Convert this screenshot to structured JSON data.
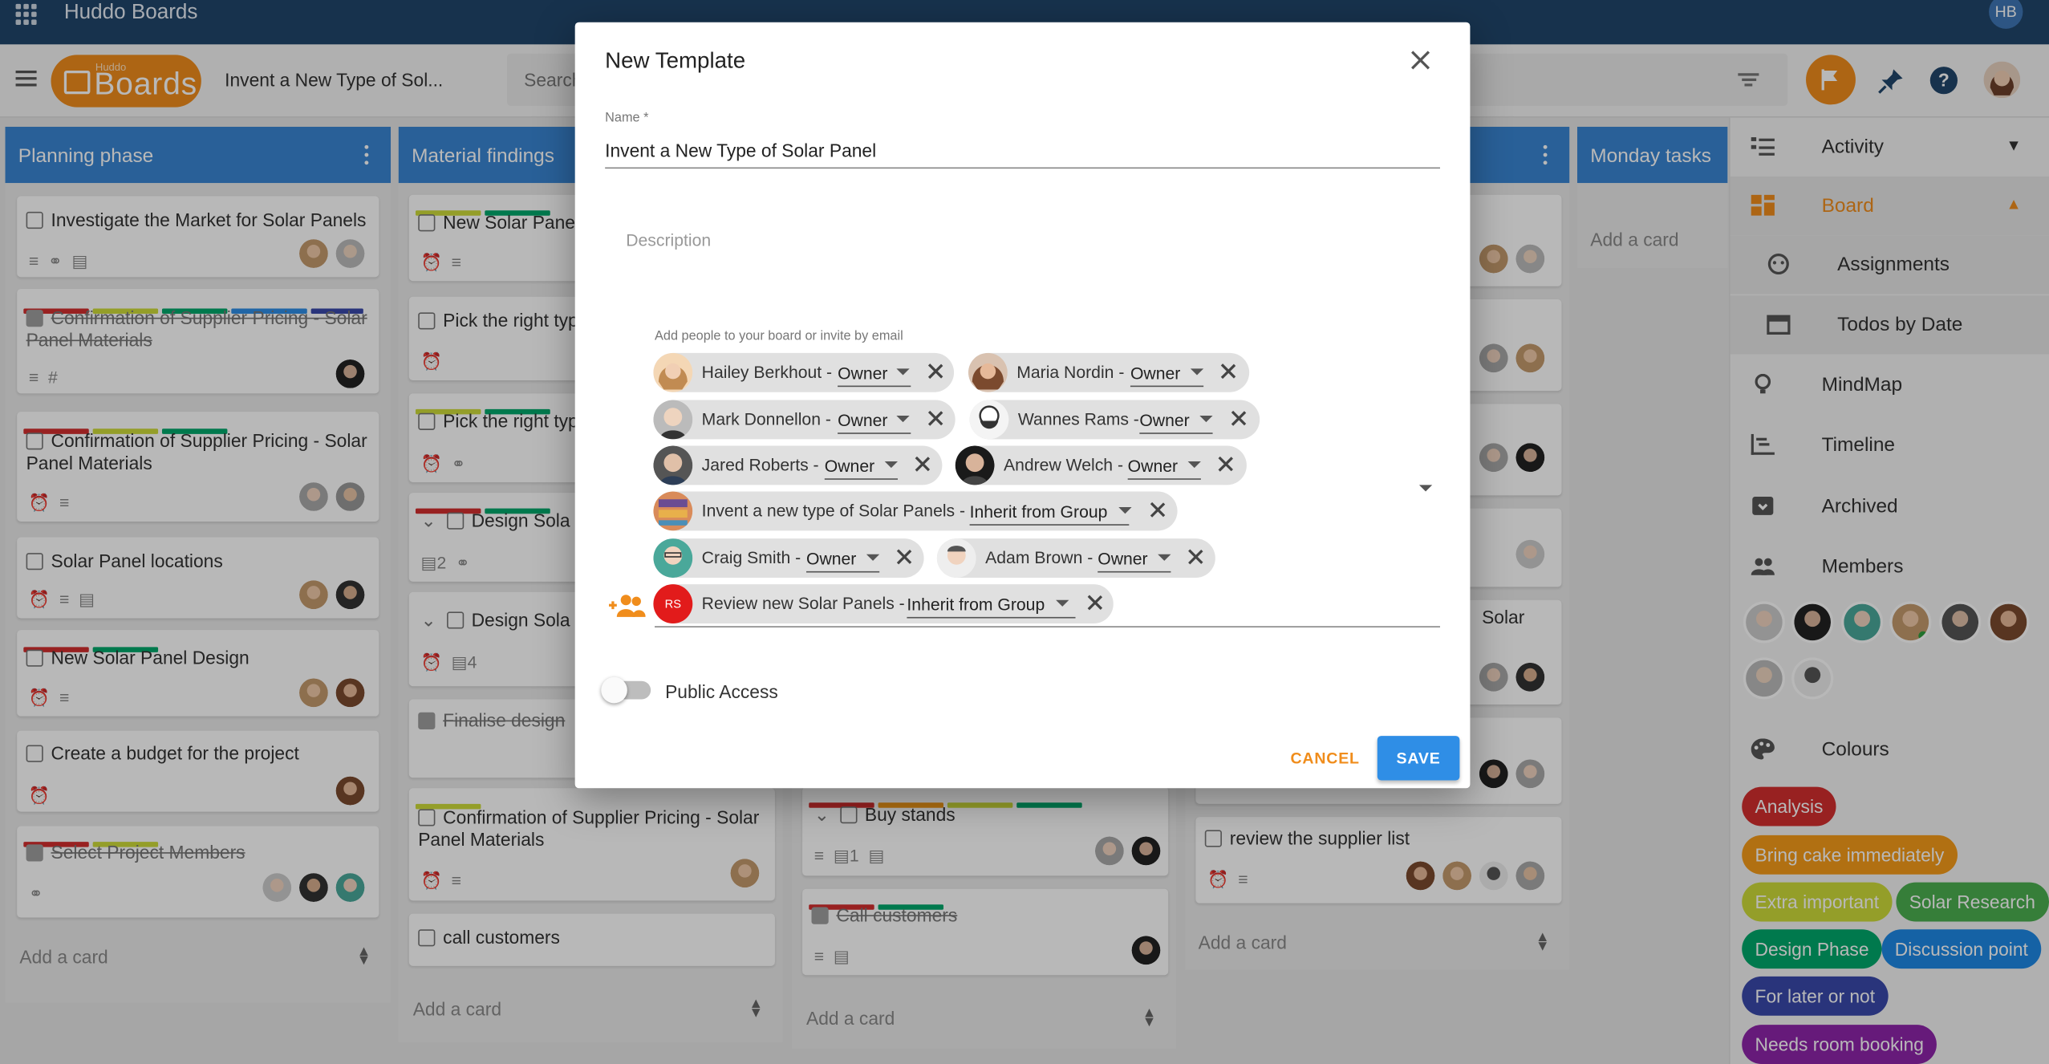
{
  "app": {
    "name": "Huddo Boards",
    "user_initials": "HB"
  },
  "header": {
    "logo_small": "Huddo",
    "logo_big": "Boards",
    "board_title": "Invent a New Type of Sol...",
    "search_placeholder": "Search"
  },
  "lists": [
    {
      "title": "Planning phase",
      "cards": [
        {
          "title": "Investigate the Market for Solar Panels",
          "done": false
        },
        {
          "title": "Confirmation of Supplier Pricing - Solar Panel Materials",
          "done": true
        },
        {
          "title": "Confirmation of Supplier Pricing - Solar Panel Materials",
          "done": false
        },
        {
          "title": "Solar Panel locations",
          "done": false
        },
        {
          "title": "New Solar Panel Design",
          "done": false
        },
        {
          "title": "Create a budget for the project",
          "done": false
        },
        {
          "title": "Select Project Members",
          "done": true
        }
      ],
      "add_card": "Add a card"
    },
    {
      "title": "Material findings",
      "cards": [
        {
          "title": "New Solar Panel",
          "done": false
        },
        {
          "title": "Pick the right typ",
          "done": false
        },
        {
          "title": "Pick the right typ",
          "done": false
        },
        {
          "title": "Design Sola",
          "done": false,
          "count": "2"
        },
        {
          "title": "Design Sola",
          "done": false,
          "count": "4"
        },
        {
          "title": "Finalise design",
          "done": true
        },
        {
          "title": "Confirmation of Supplier Pricing - Solar Panel Materials",
          "done": false
        },
        {
          "title": "call customers",
          "done": false
        }
      ],
      "add_card": "Add a card"
    },
    {
      "title": "",
      "cards": [
        {
          "title": "Buy stands",
          "done": false,
          "count": "1"
        },
        {
          "title": "Call customers",
          "done": true
        }
      ],
      "add_card": "Add a card"
    },
    {
      "title": "",
      "cards": [
        {
          "title": "Solar",
          "done": false
        },
        {
          "title": "review the supplier list",
          "done": false
        }
      ],
      "add_card": "Add a card"
    },
    {
      "title": "Monday tasks",
      "cards": [],
      "add_card": "Add a card"
    }
  ],
  "right_panel": {
    "items": [
      {
        "label": "Activity",
        "icon": "activity-icon"
      },
      {
        "label": "Board",
        "icon": "board-icon"
      },
      {
        "label": "Assignments",
        "icon": "assignments-icon"
      },
      {
        "label": "Todos by Date",
        "icon": "calendar-icon"
      },
      {
        "label": "MindMap",
        "icon": "lightbulb-icon"
      },
      {
        "label": "Timeline",
        "icon": "timeline-icon"
      },
      {
        "label": "Archived",
        "icon": "archive-icon"
      },
      {
        "label": "Members",
        "icon": "members-icon"
      }
    ],
    "colours_title": "Colours",
    "chips": [
      {
        "label": "Analysis",
        "color": "#d32f2f"
      },
      {
        "label": "Bring cake immediately",
        "color": "#f59c1a"
      },
      {
        "label": "Extra important",
        "color": "#cddc39"
      },
      {
        "label": "Solar Research",
        "color": "#4caf50"
      },
      {
        "label": "Design Phase",
        "color": "#00a86b"
      },
      {
        "label": "Discussion point",
        "color": "#1e88e5"
      },
      {
        "label": "For later or not",
        "color": "#3949ab"
      },
      {
        "label": "Needs room booking",
        "color": "#8e24aa"
      }
    ]
  },
  "modal": {
    "title": "New Template",
    "name_label": "Name *",
    "name_value": "Invent a New Type of Solar Panel",
    "description_placeholder": "Description",
    "people_label": "Add people to your board or invite by email",
    "people": [
      {
        "name": "Hailey Berkhout -",
        "role": "Owner"
      },
      {
        "name": "Maria Nordin -",
        "role": "Owner"
      },
      {
        "name": "Mark Donnellon -",
        "role": "Owner"
      },
      {
        "name": "Wannes Rams -",
        "role": "Owner"
      },
      {
        "name": "Jared Roberts -",
        "role": "Owner"
      },
      {
        "name": "Andrew Welch -",
        "role": "Owner"
      },
      {
        "name": "Invent a new type of Solar Panels -",
        "role": "Inherit from Group"
      },
      {
        "name": "Craig Smith -",
        "role": "Owner"
      },
      {
        "name": "Adam Brown -",
        "role": "Owner"
      },
      {
        "name": "Review new Solar Panels -",
        "role": "Inherit from Group",
        "initials": "RS"
      }
    ],
    "public_access_label": "Public Access",
    "cancel_label": "CANCEL",
    "save_label": "SAVE"
  }
}
